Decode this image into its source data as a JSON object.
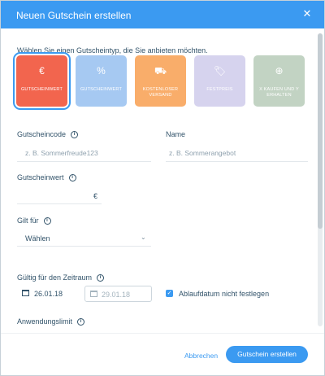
{
  "dialog": {
    "title": "Neuen Gutschein erstellen",
    "close_icon": "close-icon"
  },
  "intro": "Wählen Sie einen Gutscheintyp, die Sie anbieten möchten.",
  "voucher_types": [
    {
      "label": "GUTSCHEINWERT",
      "icon": "€",
      "color": "#f2654e",
      "selected": true
    },
    {
      "label": "GUTSCHEINWERT",
      "icon": "%",
      "color": "#a6c9f2",
      "selected": false
    },
    {
      "label": "KOSTENLOSER VERSAND",
      "icon": "⛟",
      "color": "#f9ad6a",
      "selected": false
    },
    {
      "label": "FESTPREIS",
      "icon": "🏷",
      "color": "#d6d3ee",
      "selected": false
    },
    {
      "label": "X KAUFEN UND Y ERHALTEN",
      "icon": "⊕",
      "color": "#c2d3c3",
      "selected": false
    }
  ],
  "form": {
    "code_label": "Gutscheincode",
    "code_placeholder": "z. B. Sommerfreude123",
    "name_label": "Name",
    "name_placeholder": "z. B. Sommerangebot",
    "value_label": "Gutscheinwert",
    "value_currency": "€",
    "valid_for_label": "Gilt für",
    "valid_for_value": "Wählen",
    "period_label": "Gültig für den Zeitraum",
    "start_date": "26.01.18",
    "end_date_placeholder": "29.01.18",
    "no_expiry_label": "Ablaufdatum nicht festlegen",
    "no_expiry_checked": true,
    "usage_limit_label": "Anwendungslimit"
  },
  "footer": {
    "cancel_label": "Abbrechen",
    "create_label": "Gutschein erstellen"
  },
  "colors": {
    "accent": "#3b9af1",
    "text": "#32536a"
  }
}
